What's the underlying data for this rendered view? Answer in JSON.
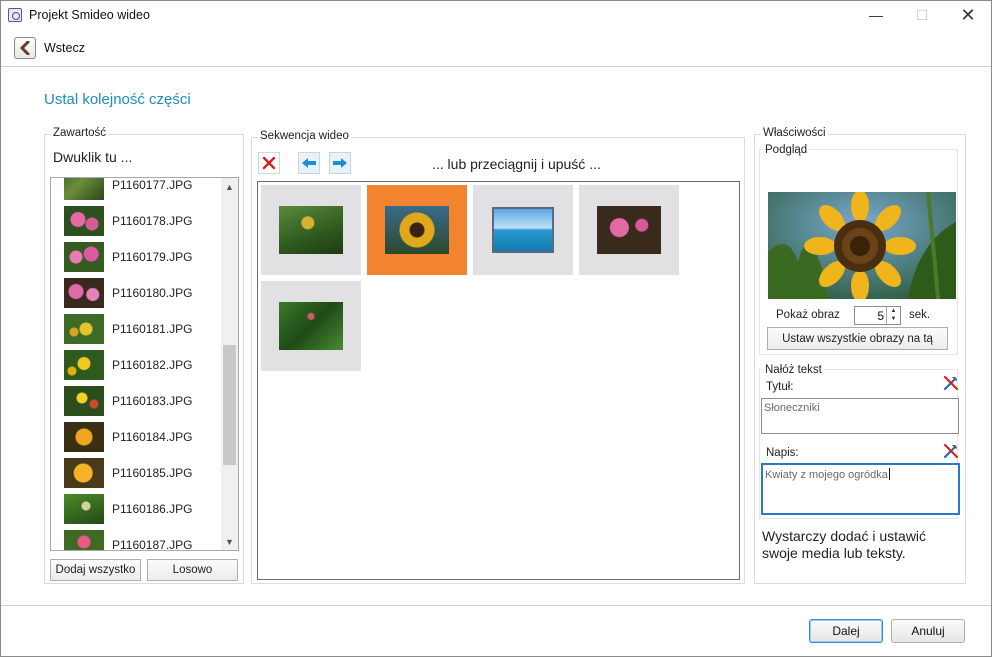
{
  "window": {
    "title": "Projekt Smideo wideo",
    "minimize_icon": "minimize-icon",
    "maximize_icon": "maximize-icon",
    "close_icon": "close-icon"
  },
  "backbar": {
    "label": "Wstecz"
  },
  "page": {
    "title": "Ustal kolejność części"
  },
  "content_panel": {
    "legend": "Zawartość",
    "hint": "Dwuklik tu ...",
    "files": [
      "P1160177.JPG",
      "P1160178.JPG",
      "P1160179.JPG",
      "P1160180.JPG",
      "P1160181.JPG",
      "P1160182.JPG",
      "P1160183.JPG",
      "P1160184.JPG",
      "P1160185.JPG",
      "P1160186.JPG",
      "P1160187.JPG"
    ],
    "add_all_label": "Dodaj wszystko",
    "random_label": "Losowo"
  },
  "sequence_panel": {
    "legend": "Sekwencja wideo",
    "drop_hint": "... lub przeciągnij i upuść ...",
    "item_count": 5,
    "selected_index": 1
  },
  "properties_panel": {
    "legend": "Właściwości",
    "preview_legend": "Podgląd",
    "show_image_label": "Pokaż obraz",
    "show_image_value": "5",
    "seconds_label": "sek.",
    "set_all_label": "Ustaw wszystkie obrazy na tą",
    "text_legend": "Nałóż tekst",
    "title_label": "Tytuł:",
    "title_value": "Słoneczniki",
    "caption_label": "Napis:",
    "caption_value": "Kwiaty z mojego ogródka",
    "info": "Wystarczy dodać i ustawić swoje media lub teksty."
  },
  "footer": {
    "next_label": "Dalej",
    "cancel_label": "Anuluj"
  },
  "colors": {
    "accent": "#1b8dbf",
    "selected": "#f2832f",
    "separator": "#e3c7b6"
  }
}
